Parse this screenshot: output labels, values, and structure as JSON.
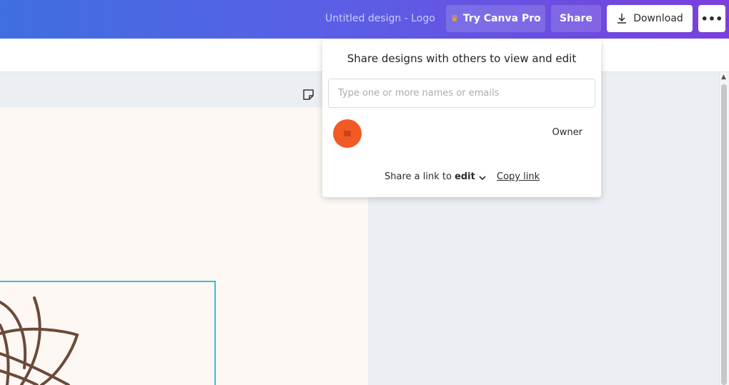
{
  "header": {
    "design_title": "Untitled design - Logo",
    "try_pro_label": "Try Canva Pro",
    "share_label": "Share",
    "download_label": "Download",
    "more_label": "•••"
  },
  "share_popover": {
    "title": "Share designs with others to view and edit",
    "input_placeholder": "Type one or more names or emails",
    "input_value": "",
    "member_role": "Owner",
    "link_prefix": "Share a link to",
    "link_permission": "edit",
    "copy_link_label": "Copy link"
  },
  "icons": {
    "crown": "crown-icon",
    "download": "download-icon",
    "more": "more-icon",
    "notes": "notes-icon",
    "chevron": "chevron-down-icon"
  },
  "colors": {
    "accent_start": "#3f6fe0",
    "accent_end": "#7a3fdc",
    "avatar": "#f15a24",
    "selection": "#2fc6d3",
    "logo_stroke": "#6b4a3a"
  }
}
